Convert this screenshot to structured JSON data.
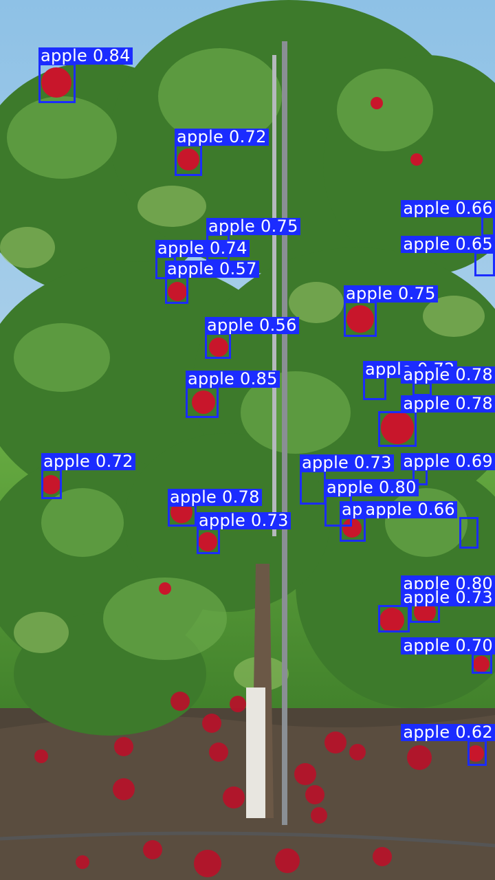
{
  "colors": {
    "box": "#1b2cff",
    "label_text": "#ffffff",
    "sky": "#8ec1e6",
    "foliage": "#3f7a2a",
    "grass": "#5aa23a",
    "soil": "#4a3f35",
    "apple": "#c8162b"
  },
  "detections": [
    {
      "label": "apple 0.84"
    },
    {
      "label": "apple 0.72"
    },
    {
      "label": "apple 0.66"
    },
    {
      "label": "apple 0.75"
    },
    {
      "label": "apple 0.65"
    },
    {
      "label": "apple 0.74"
    },
    {
      "label": "apple 0.57"
    },
    {
      "label": "apple 0.75"
    },
    {
      "label": "apple 0.56"
    },
    {
      "label": "apple 0.72"
    },
    {
      "label": "apple 0.78"
    },
    {
      "label": "apple 0.85"
    },
    {
      "label": "apple 0.78"
    },
    {
      "label": "apple 0.72"
    },
    {
      "label": "apple 0.73"
    },
    {
      "label": "apple 0.69"
    },
    {
      "label": "apple 0.80"
    },
    {
      "label": "apple 0.78"
    },
    {
      "label": "apple 0.73"
    },
    {
      "label": "apple 0.73"
    },
    {
      "label": "apple 0.66"
    },
    {
      "label": "apple 0.80"
    },
    {
      "label": "apple 0.73"
    },
    {
      "label": "apple 0.70"
    },
    {
      "label": "apple 0.62"
    }
  ]
}
